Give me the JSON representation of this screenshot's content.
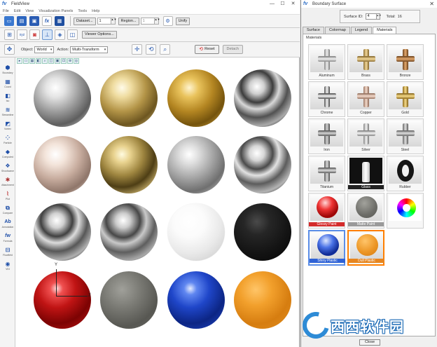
{
  "main_window": {
    "title": "FieldView",
    "controls": [
      "—",
      "☐",
      "✕"
    ],
    "menu": [
      "File",
      "Edit",
      "View",
      "Visualization Panels",
      "Tools",
      "Help"
    ]
  },
  "toolbar1": {
    "dataset_label": "Dataset...",
    "dataset_value": "1",
    "region_label": "Region...",
    "region_value": "1",
    "unify_label": "Unify"
  },
  "toolbar2": {
    "viewer_options_label": "Viewer Options..."
  },
  "toolbar3": {
    "object_label": "Object:",
    "object_value": "World",
    "action_label": "Action:",
    "action_value": "Multi-Transform",
    "reset_label": "Reset",
    "detach_label": "Detach"
  },
  "sidebar": [
    {
      "label": "Boundary",
      "icon": "surface-icon"
    },
    {
      "label": "Coord",
      "icon": "coord-icon"
    },
    {
      "label": "Iso",
      "icon": "iso-icon"
    },
    {
      "label": "Streamline",
      "icon": "streamline-icon"
    },
    {
      "label": "Vortex",
      "icon": "vortex-icon"
    },
    {
      "label": "Particle",
      "icon": "particle-icon"
    },
    {
      "label": "Computed",
      "icon": "computed-icon"
    },
    {
      "label": "Shockwave",
      "icon": "shock-icon"
    },
    {
      "label": "Attachment",
      "icon": "attachment-icon"
    },
    {
      "label": "Plot",
      "icon": "plot-icon"
    },
    {
      "label": "Compare",
      "icon": "compare-icon"
    },
    {
      "label": "Annotation",
      "icon": "annotation-icon"
    },
    {
      "label": "Formula",
      "icon": "formula-icon"
    },
    {
      "label": "Flowfield",
      "icon": "flowfield-icon"
    },
    {
      "label": "VDI",
      "icon": "vdi-icon"
    }
  ],
  "sidebar_glyphs": {
    "annotation": "Ab",
    "formula": "fw"
  },
  "axes": {
    "y": "Y",
    "z": "Z"
  },
  "dialog": {
    "title": "Boundary Surface",
    "surface_id_label": "Surface ID:",
    "surface_id_value": "4",
    "total_label": "Total:",
    "total_value": "16",
    "tabs": [
      "Surface",
      "Colormap",
      "Legend",
      "Materials"
    ],
    "active_tab": "Materials",
    "panel_header": "Materials",
    "close_label": "Close",
    "materials": [
      {
        "name": "Aluminum",
        "color": "#c8c8c8"
      },
      {
        "name": "Brass",
        "color": "#d8b36a"
      },
      {
        "name": "Bronze",
        "color": "#b87f45"
      },
      {
        "name": "Chrome",
        "color": "#b7b7b7"
      },
      {
        "name": "Copper",
        "color": "#d4a38a"
      },
      {
        "name": "Gold",
        "color": "#cfa94e"
      },
      {
        "name": "Iron",
        "color": "#9c9c9c"
      },
      {
        "name": "Silver",
        "color": "#c4c4c4"
      },
      {
        "name": "Steel",
        "color": "#a9a9a9"
      },
      {
        "name": "Titanium",
        "color": "#a5a5a5"
      },
      {
        "name": "Glass",
        "color": "#e8e8e8"
      },
      {
        "name": "Rubber",
        "color": "#1a1a1a"
      },
      {
        "name": "Glossy Paint",
        "color": "#c61818"
      },
      {
        "name": "Matte Paint",
        "color": "#6d6d68"
      },
      {
        "name": "",
        "color": "#ffffff"
      },
      {
        "name": "Shiny Plastic",
        "color": "#1d44c4"
      },
      {
        "name": "Dull Plastic",
        "color": "#e48a1c"
      }
    ]
  },
  "watermark": {
    "text": "西西软件园"
  }
}
